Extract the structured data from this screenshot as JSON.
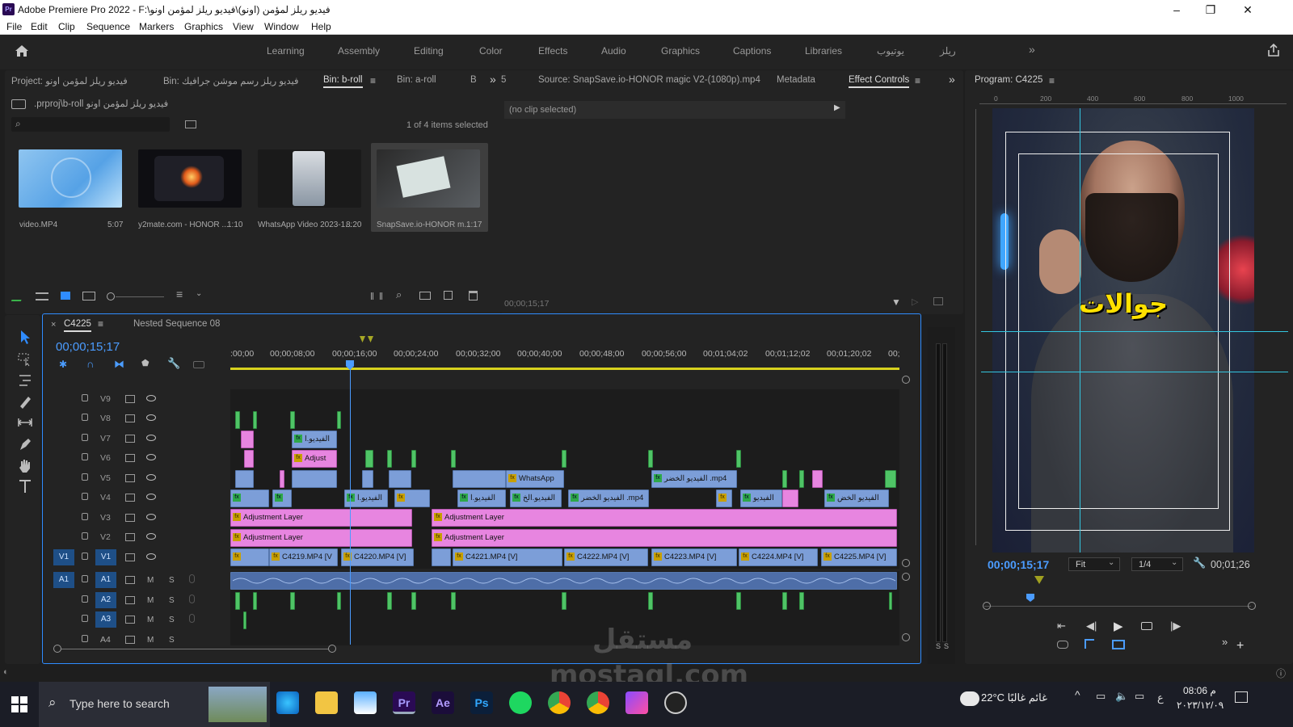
{
  "window": {
    "title": "Adobe Premiere Pro 2022 - F:\\فيديو ريلز لمؤمن (اونو)\\فيديو  ريلز لمؤمن اونو",
    "app_icon": "Pr"
  },
  "menu": [
    "File",
    "Edit",
    "Clip",
    "Sequence",
    "Markers",
    "Graphics",
    "View",
    "Window",
    "Help"
  ],
  "workspaces": [
    "Learning",
    "Assembly",
    "Editing",
    "Color",
    "Effects",
    "Audio",
    "Graphics",
    "Captions",
    "Libraries",
    "يوتيوب",
    "ريلز"
  ],
  "project_panel": {
    "tabs": [
      "Project: فيديو  ريلز لمؤمن اونو",
      "Bin: فيديو ريلز رسم موشن جرافيك",
      "Bin: b-roll",
      "Bin: a-roll",
      "B"
    ],
    "active_tab": "Bin: b-roll",
    "path": ".prproj\\b-roll فيديو  ريلز لمؤمن اونو",
    "search_placeholder": "",
    "items_selected": "1 of 4 items selected",
    "items": [
      {
        "name": "video.MP4",
        "duration": "5:07"
      },
      {
        "name": "y2mate.com - HONOR ...",
        "duration": "1:10"
      },
      {
        "name": "WhatsApp Video 2023-1...",
        "duration": "8:20"
      },
      {
        "name": "SnapSave.io-HONOR m...",
        "duration": "1:17"
      }
    ]
  },
  "source_panel": {
    "tabs": [
      "5",
      "Source: SnapSave.io-HONOR magic V2-(1080p).mp4",
      "Metadata",
      "Effect Controls"
    ],
    "active_tab": "Effect Controls",
    "no_clip": "(no clip selected)",
    "timecode": "00;00;15;17"
  },
  "program_panel": {
    "title": "Program: C4225",
    "ruler": [
      "0",
      "200",
      "400",
      "600",
      "800",
      "1000"
    ],
    "overlay_text": "جوالات",
    "timecode": "00;00;15;17",
    "fit": "Fit",
    "resolution": "1/4",
    "duration": "00;01;26"
  },
  "timeline": {
    "tabs": [
      "C4225",
      "Nested Sequence 08"
    ],
    "timecode": "00;00;15;17",
    "ruler": [
      ":00;00",
      "00;00;08;00",
      "00;00;16;00",
      "00;00;24;00",
      "00;00;32;00",
      "00;00;40;00",
      "00;00;48;00",
      "00;00;56;00",
      "00;01;04;02",
      "00;01;12;02",
      "00;01;20;02",
      "00;"
    ],
    "video_tracks": [
      "V9",
      "V8",
      "V7",
      "V6",
      "V5",
      "V4",
      "V3",
      "V2",
      "V1"
    ],
    "audio_tracks": [
      "A1",
      "A2",
      "A3",
      "A4"
    ],
    "clips": {
      "v7": "الفيديو.ا",
      "v6": "Adjust",
      "v5a": "WhatsApp",
      "v5b": "الفيديو الخضر .mp4",
      "v4a": "الفيديو.ا",
      "v4b": "الفيديو.ا",
      "v4c": "الفيديو.الخ",
      "v4d": "الفيديو الخضر .mp4",
      "v4e": "الفيديو",
      "v4f": "الفيديو الخض",
      "v3a": "Adjustment Layer",
      "v3b": "Adjustment Layer",
      "v2a": "Adjustment Layer",
      "v2b": "Adjustment Layer",
      "v1": [
        "C4219.MP4 [V",
        "C4220.MP4 [V]",
        "C4221.MP4 [V]",
        "C4222.MP4 [V]",
        "C4223.MP4 [V]",
        "C4224.MP4 [V]",
        "C4225.MP4 [V]"
      ]
    }
  },
  "taskbar": {
    "search_placeholder": "Type here to search",
    "weather": "22°C  غائم غالبًا",
    "time": "08:06 م",
    "date": "٢٠٢٣/١٢/٠٩",
    "lang": "ع"
  },
  "watermark": "مستقل mostaql.com",
  "colors": {
    "accent_blue": "#2f8cff",
    "playhead": "#4b9cff",
    "clip_blue": "#7c9ed8",
    "clip_pink": "#e785e0",
    "clip_green": "#4fc466"
  }
}
